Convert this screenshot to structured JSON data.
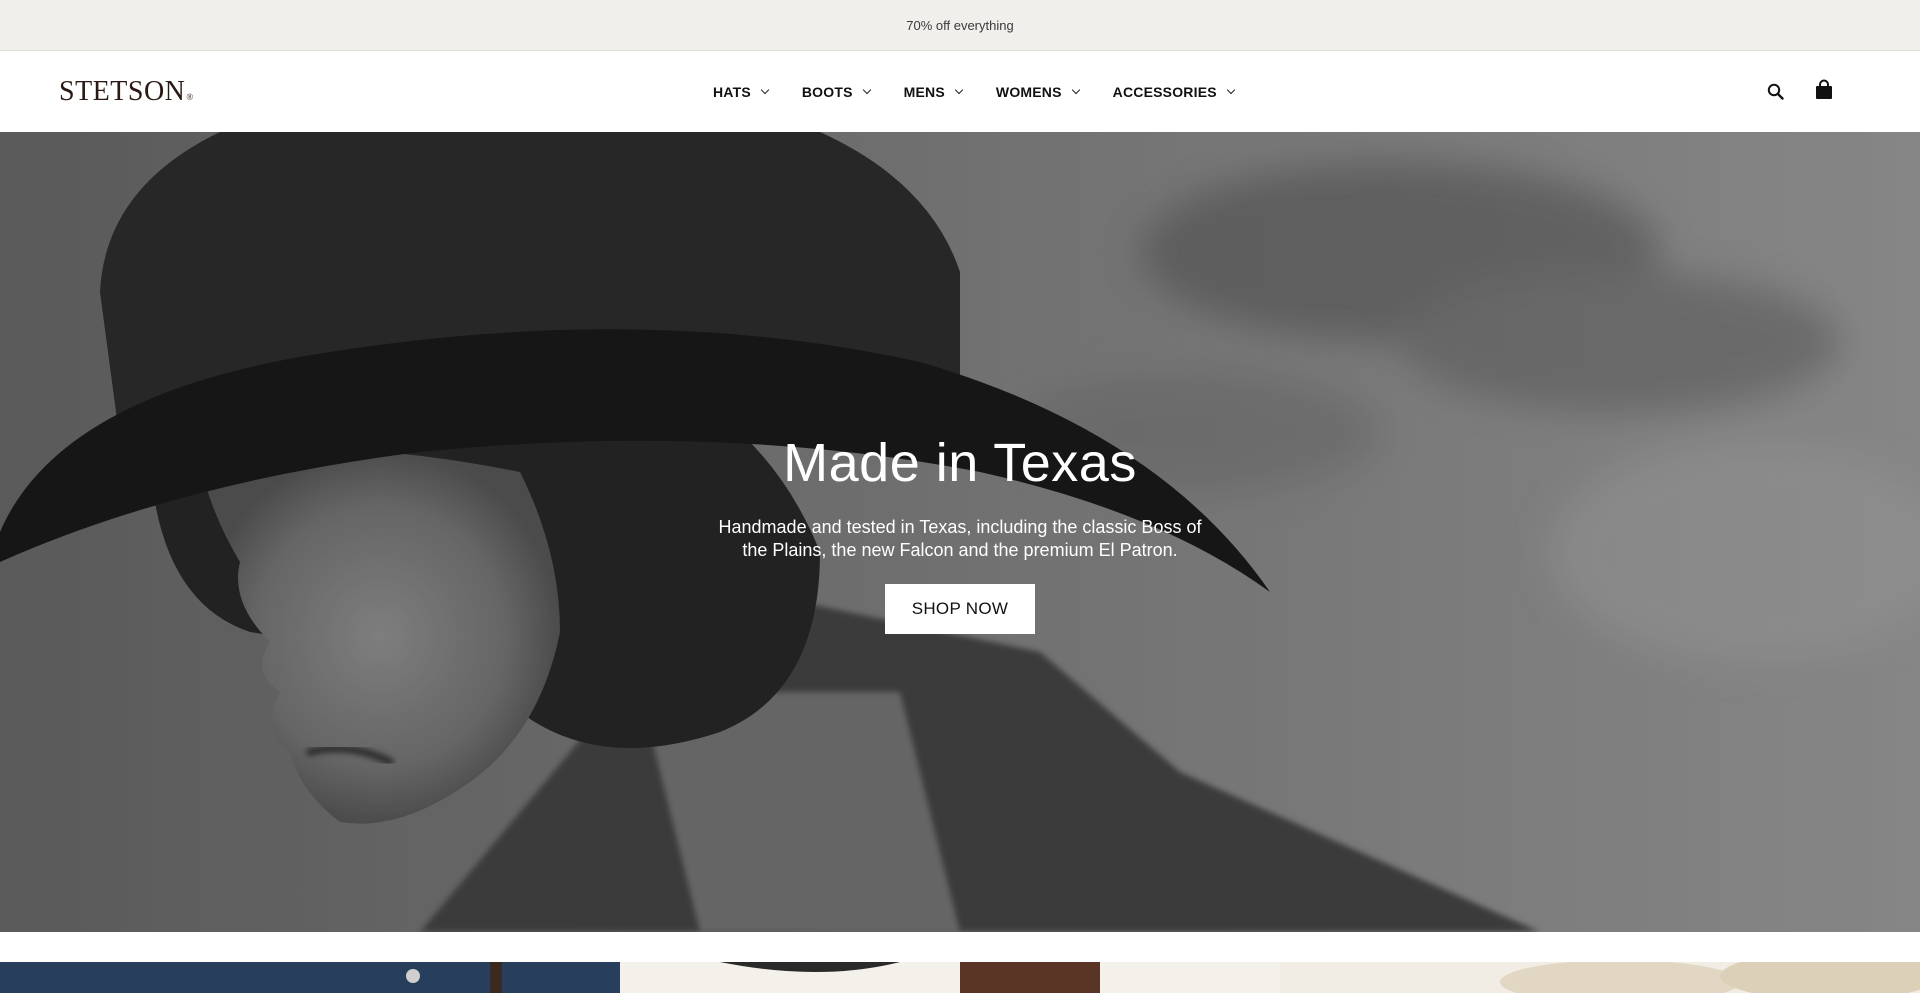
{
  "announcement": {
    "text": "70% off everything"
  },
  "header": {
    "logo_text": "STETSON",
    "logo_mark": "®",
    "nav": [
      {
        "label": "HATS"
      },
      {
        "label": "BOOTS"
      },
      {
        "label": "MENS"
      },
      {
        "label": "WOMENS"
      },
      {
        "label": "ACCESSORIES"
      }
    ],
    "icons": {
      "search": "search-icon",
      "cart": "shopping-bag-icon"
    }
  },
  "hero": {
    "title": "Made in Texas",
    "subtitle": "Handmade and tested in Texas, including the classic Boss of the Plains, the new Falcon and the premium El Patron.",
    "cta_label": "SHOP NOW",
    "image": "black-and-white photo of a man in a cowboy hat"
  },
  "colors": {
    "announcement_bg": "#f1efeb",
    "brand_text": "#2b1a14",
    "cta_bg": "#ffffff"
  }
}
